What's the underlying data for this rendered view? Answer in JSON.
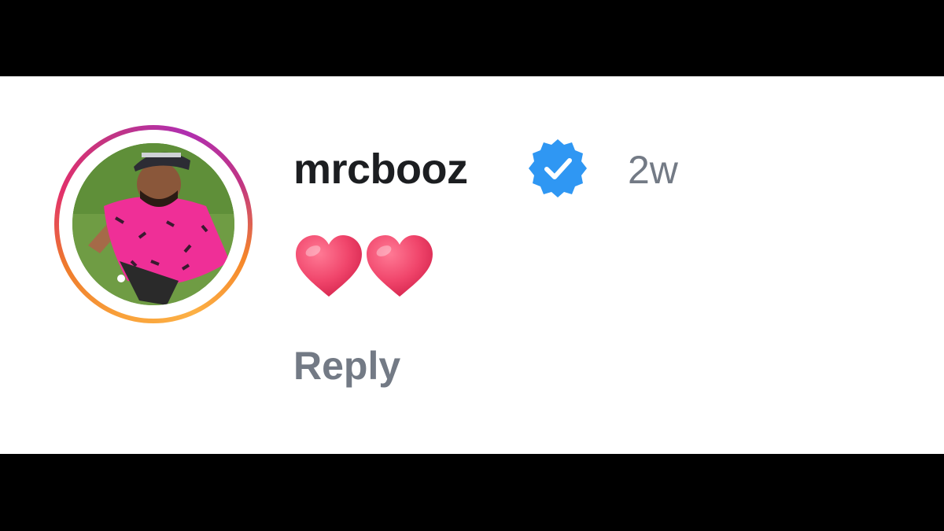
{
  "comment": {
    "username": "mrcbooz",
    "verified": true,
    "timestamp": "2w",
    "text_emoji": "❤️❤️",
    "reply_label": "Reply"
  },
  "colors": {
    "verified_badge": "#2f97f3",
    "username": "#1c1e21",
    "meta_text": "#737a85",
    "heart": "#f0456b"
  },
  "icons": {
    "verified": "verified-badge-icon",
    "heart": "red-heart-emoji"
  }
}
